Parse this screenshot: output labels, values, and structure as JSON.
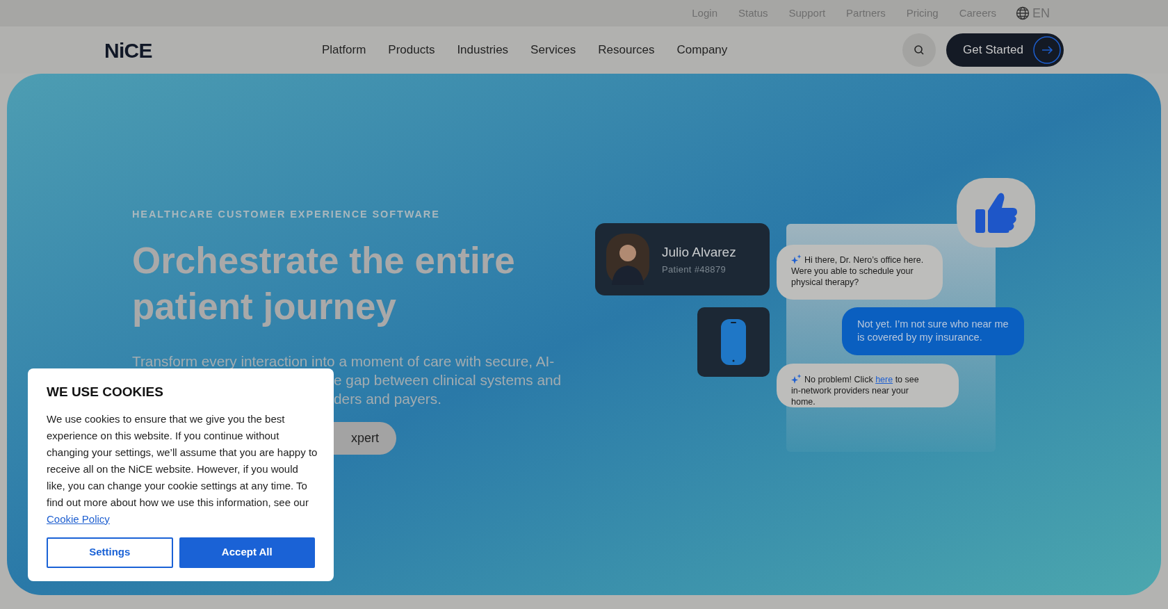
{
  "top_bar": {
    "links": [
      "Login",
      "Status",
      "Support",
      "Partners",
      "Pricing",
      "Careers"
    ],
    "language": "EN"
  },
  "nav": {
    "logo": "NiCE",
    "items": [
      "Platform",
      "Products",
      "Industries",
      "Services",
      "Resources",
      "Company"
    ],
    "cta": "Get Started"
  },
  "hero": {
    "eyebrow": "HEALTHCARE CUSTOMER EXPERIENCE SOFTWARE",
    "headline": "Orchestrate the entire patient journey",
    "paragraph_fragments": [
      "Transform every interaction into a moment of care with secure, AI-",
      "e gap between clinical systems and",
      "ders and payers."
    ],
    "button_fragment": "xpert"
  },
  "chat": {
    "contact": {
      "name": "Julio Alvarez",
      "id": "Patient #48879"
    },
    "messages": [
      {
        "kind": "bot",
        "first": {
          "before": "Hi there, Dr. Nero’s office here."
        },
        "rest": "Were you able to schedule your physical therapy?"
      },
      {
        "kind": "user",
        "first": {
          "before": "Not yet. I’m not sure who near me is covered by my insurance."
        }
      },
      {
        "kind": "bot",
        "first": {
          "before": "No problem! Click ",
          "link": "here",
          "after": " to see"
        },
        "rest": "in-network providers near your home."
      }
    ]
  },
  "cookie_dialog": {
    "title": "WE USE COOKIES",
    "body": "We use cookies to ensure that we give you the best experience on this website. If you continue without changing your settings, we’ll assume that you are happy to receive all on the NiCE website. However, if you would like, you can change your cookie settings at any time. To find out more about how we use this information, see our ",
    "link": "Cookie Policy",
    "buttons": [
      {
        "label": "Settings",
        "kind": "secondary"
      },
      {
        "label": "Accept All",
        "kind": "primary"
      }
    ]
  }
}
